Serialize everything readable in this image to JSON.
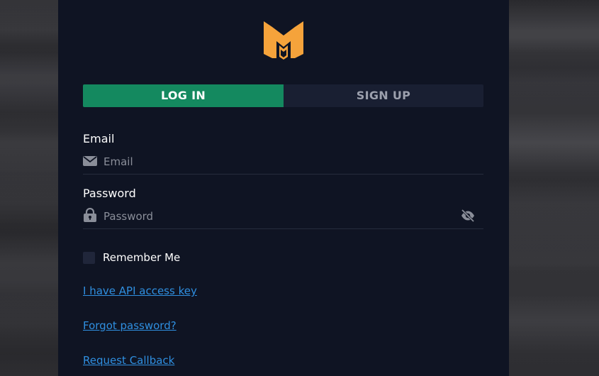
{
  "colors": {
    "panel_bg": "#0f1423",
    "accent_green": "#14895f",
    "logo_orange": "#f5a33b",
    "link_blue": "#2f8fe0",
    "tab_inactive_bg": "#191f32"
  },
  "logo": {
    "icon": "brand-logo-icon"
  },
  "tabs": {
    "login_label": "LOG IN",
    "signup_label": "SIGN UP",
    "active": "login"
  },
  "email": {
    "label": "Email",
    "placeholder": "Email",
    "value": "",
    "icon": "envelope-icon"
  },
  "password": {
    "label": "Password",
    "placeholder": "Password",
    "value": "",
    "icon": "lock-icon",
    "toggle_icon": "eye-slash-icon"
  },
  "remember": {
    "label": "Remember Me",
    "checked": false
  },
  "links": {
    "api_key": "I have API access key",
    "forgot": "Forgot password?",
    "callback": "Request Callback"
  }
}
